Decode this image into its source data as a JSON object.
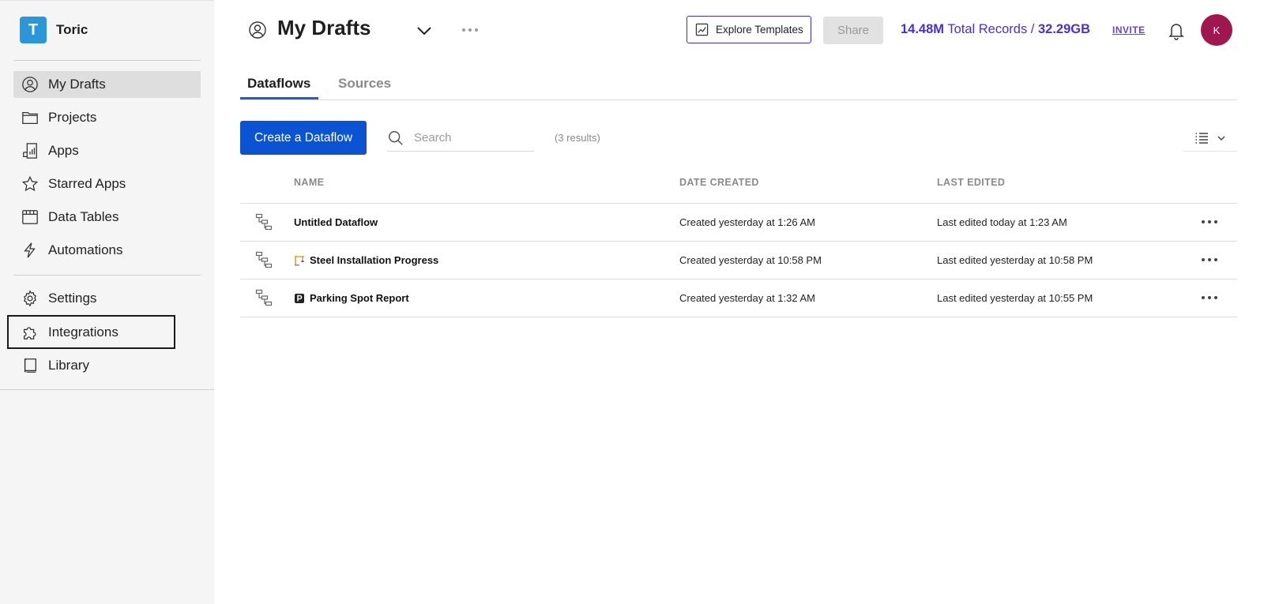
{
  "brand": {
    "logo_letter": "T",
    "name": "Toric",
    "logo_color": "#2a97d8"
  },
  "sidebar": {
    "items": [
      {
        "label": "My Drafts",
        "icon": "user-circle-icon"
      },
      {
        "label": "Projects",
        "icon": "folder-icon"
      },
      {
        "label": "Apps",
        "icon": "app-chart-icon"
      },
      {
        "label": "Starred Apps",
        "icon": "star-icon"
      },
      {
        "label": "Data Tables",
        "icon": "table-icon"
      },
      {
        "label": "Automations",
        "icon": "lightning-icon"
      },
      {
        "label": "Settings",
        "icon": "gear-icon"
      },
      {
        "label": "Integrations",
        "icon": "puzzle-icon"
      },
      {
        "label": "Library",
        "icon": "book-icon"
      }
    ]
  },
  "header": {
    "title": "My Drafts",
    "explore_label": "Explore Templates",
    "share_label": "Share",
    "records_count": "14.48M",
    "records_label": " Total Records / ",
    "storage": "32.29GB",
    "invite_label": "INVITE",
    "avatar_initial": "K",
    "avatar_color": "#a0174f",
    "accent_color": "#4a2fd8"
  },
  "tabs": [
    {
      "label": "Dataflows",
      "active": true
    },
    {
      "label": "Sources",
      "active": false
    }
  ],
  "toolbar": {
    "create_label": "Create a Dataflow",
    "search_placeholder": "Search",
    "results": "(3 results)"
  },
  "table": {
    "columns": [
      "NAME",
      "DATE CREATED",
      "LAST EDITED"
    ],
    "rows": [
      {
        "name": "Untitled Dataflow",
        "emoji": "",
        "created": "Created yesterday at 1:26 AM",
        "edited": "Last edited today at 1:23 AM"
      },
      {
        "name": "Steel Installation Progress",
        "emoji": "construction-crane-emoji",
        "created": "Created yesterday at 10:58 PM",
        "edited": "Last edited yesterday at 10:58 PM"
      },
      {
        "name": "Parking Spot Report",
        "emoji": "parking-sign-emoji",
        "created": "Created yesterday at 1:32 AM",
        "edited": "Last edited yesterday at 10:55 PM"
      }
    ]
  }
}
